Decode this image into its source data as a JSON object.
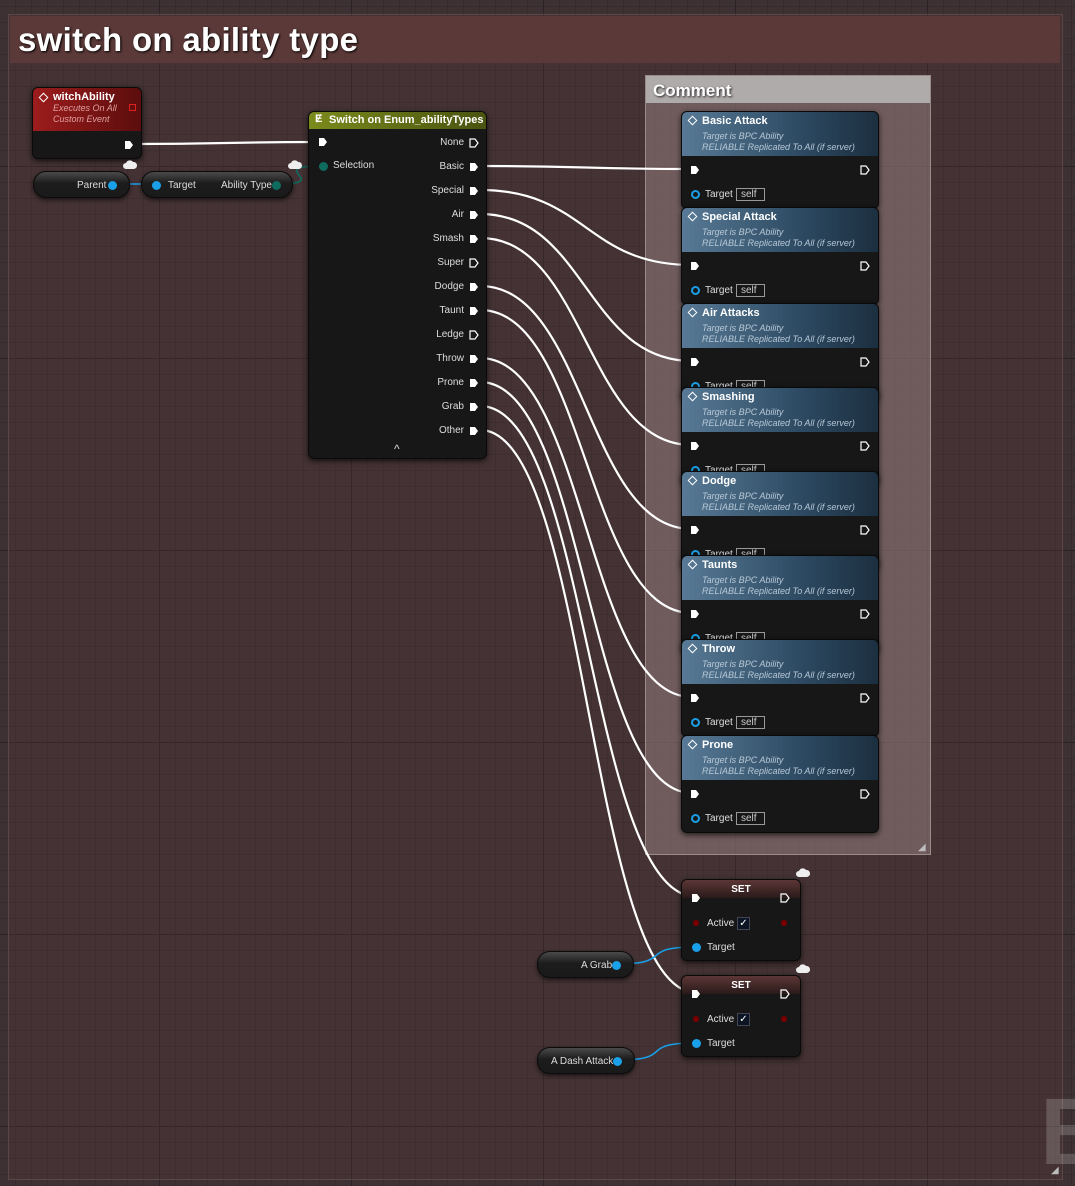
{
  "group_comment": {
    "title": "switch on ability type"
  },
  "inner_comment": {
    "title": "Comment"
  },
  "event_node": {
    "title": "witchAbility",
    "subtitle1": "Executes On All",
    "subtitle2": "Custom Event"
  },
  "parent_var": {
    "label": "Parent"
  },
  "getter_node": {
    "target_label": "Target",
    "output_label": "Ability Type"
  },
  "switch_node": {
    "title": "Switch on Enum_abilityTypes",
    "selection_label": "Selection",
    "outputs": [
      "None",
      "Basic",
      "Special",
      "Air",
      "Smash",
      "Super",
      "Dodge",
      "Taunt",
      "Ledge",
      "Throw",
      "Prone",
      "Grab",
      "Other"
    ],
    "collapse_glyph": "^"
  },
  "call_nodes": [
    {
      "title": "Basic Attack",
      "sub1": "Target is BPC Ability",
      "sub2": "RELIABLE Replicated To All (if server)",
      "target_label": "Target",
      "self_label": "self"
    },
    {
      "title": "Special Attack",
      "sub1": "Target is BPC Ability",
      "sub2": "RELIABLE Replicated To All (if server)",
      "target_label": "Target",
      "self_label": "self"
    },
    {
      "title": "Air Attacks",
      "sub1": "Target is BPC Ability",
      "sub2": "RELIABLE Replicated To All (if server)",
      "target_label": "Target",
      "self_label": "self"
    },
    {
      "title": "Smashing",
      "sub1": "Target is BPC Ability",
      "sub2": "RELIABLE Replicated To All (if server)",
      "target_label": "Target",
      "self_label": "self"
    },
    {
      "title": "Dodge",
      "sub1": "Target is BPC Ability",
      "sub2": "RELIABLE Replicated To All (if server)",
      "target_label": "Target",
      "self_label": "self"
    },
    {
      "title": "Taunts",
      "sub1": "Target is BPC Ability",
      "sub2": "RELIABLE Replicated To All (if server)",
      "target_label": "Target",
      "self_label": "self"
    },
    {
      "title": "Throw",
      "sub1": "Target is BPC Ability",
      "sub2": "RELIABLE Replicated To All (if server)",
      "target_label": "Target",
      "self_label": "self"
    },
    {
      "title": "Prone",
      "sub1": "Target is BPC Ability",
      "sub2": "RELIABLE Replicated To All (if server)",
      "target_label": "Target",
      "self_label": "self"
    }
  ],
  "set_nodes": [
    {
      "title": "SET",
      "bool_label": "Active",
      "checked": true,
      "target_label": "Target"
    },
    {
      "title": "SET",
      "bool_label": "Active",
      "checked": true,
      "target_label": "Target"
    }
  ],
  "var_nodes": [
    {
      "label": "A Grab"
    },
    {
      "label": "A Dash Attack"
    }
  ],
  "watermark": {
    "text": "B"
  },
  "colors": {
    "group_header": "#5a3938",
    "event_header": "#8c1a1a",
    "switch_header": "#5f6a16",
    "call_header": "#4e6f8a",
    "set_header": "#5a3434",
    "object_pin": "#1aa0e8",
    "enum_pin": "#0e6b5e",
    "bool_pin": "#7a0000",
    "exec_wire": "#ffffff"
  }
}
